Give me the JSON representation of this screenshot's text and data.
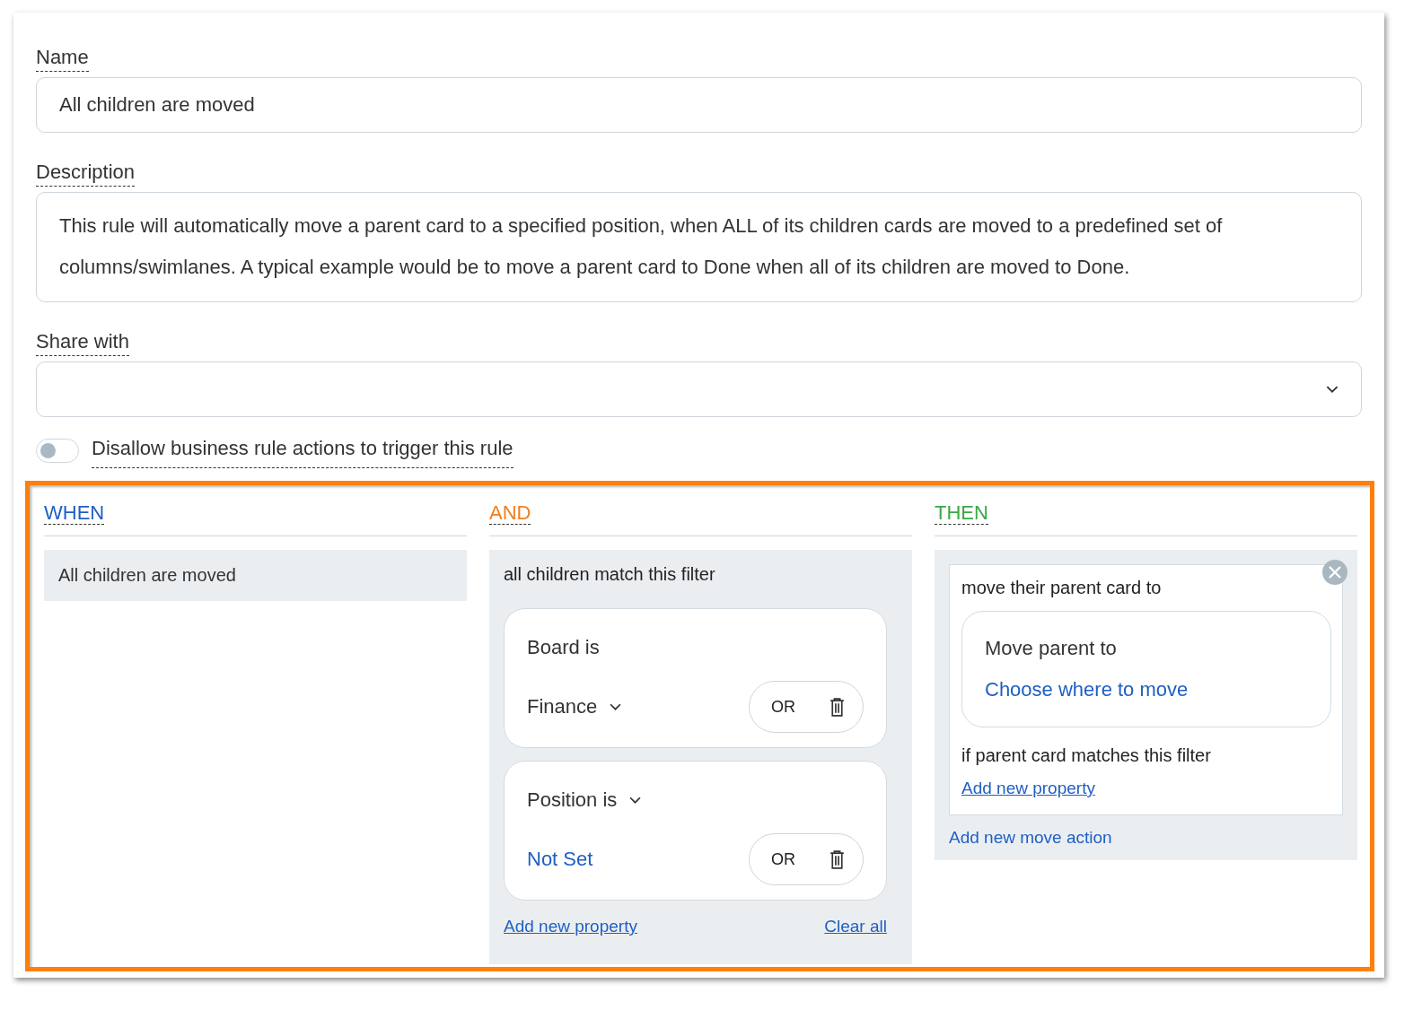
{
  "fields": [
    {
      "kind": "text",
      "label": "Name",
      "value": "All children are moved"
    },
    {
      "kind": "textarea",
      "label": "Description",
      "value": "This rule will automatically move a parent card to a specified position, when ALL of its children cards are moved to a predefined set of columns/swimlanes. A typical example would be to move a parent card to Done when all of its children are moved to Done."
    },
    {
      "kind": "select",
      "label": "Share with"
    }
  ],
  "toggle": {
    "label": "Disallow business rule actions to trigger this rule",
    "on": false
  },
  "sections": [
    {
      "kind": "trigger",
      "heading": "WHEN",
      "color": "#1f5fc4",
      "items": [
        "All children are moved"
      ]
    },
    {
      "kind": "filter",
      "heading": "AND",
      "color": "#f07f1c",
      "title": "all children match this filter",
      "conditions": [
        {
          "label": "Board is",
          "label_dropdown": false,
          "value": "Finance",
          "value_set": true,
          "value_dropdown": true,
          "or": "OR"
        },
        {
          "label": "Position is",
          "label_dropdown": true,
          "value": "Not Set",
          "value_set": false,
          "value_dropdown": false,
          "or": "OR"
        }
      ],
      "add_link": "Add new property",
      "clear_link": "Clear all"
    },
    {
      "kind": "action",
      "heading": "THEN",
      "color": "#3aa845",
      "action_title": "move their parent card to",
      "target_label": "Move parent to",
      "target_value": "Choose where to move",
      "filter_title": "if parent card matches this filter",
      "add_link": "Add new property",
      "add_action": "Add new move action"
    }
  ]
}
